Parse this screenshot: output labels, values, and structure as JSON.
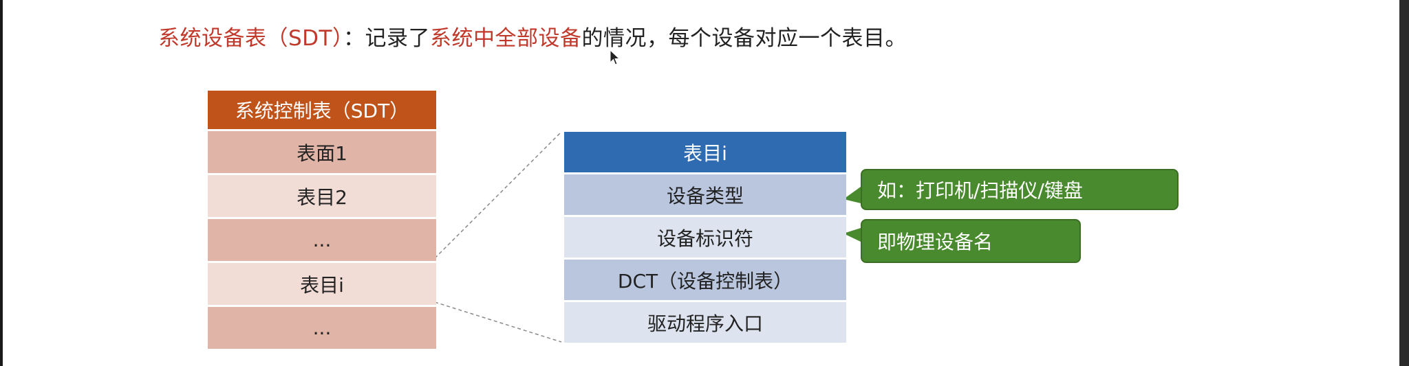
{
  "heading": {
    "term": "系统设备表（SDT）",
    "colon": "：",
    "text_before": "记录了",
    "highlight": "系统中全部设备",
    "text_after": "的情况，每个设备对应一个表目。"
  },
  "sdt_table": {
    "header": "系统控制表（SDT）",
    "rows": [
      "表面1",
      "表目2",
      "...",
      "表目i",
      "..."
    ]
  },
  "entry_table": {
    "header": "表目i",
    "rows": [
      "设备类型",
      "设备标识符",
      "DCT（设备控制表）",
      "驱动程序入口"
    ]
  },
  "callouts": {
    "device_type_note": "如：打印机/扫描仪/键盘",
    "device_id_note": "即物理设备名"
  },
  "colors": {
    "highlight_red": "#c0392b",
    "sdt_header": "#c0531a",
    "sdt_row_dark": "#e0b5a8",
    "sdt_row_light": "#f1dcd6",
    "entry_header": "#2e6bb0",
    "entry_row_dark": "#b9c6dd",
    "entry_row_light": "#dde4ef",
    "callout_green": "#4a8a2e"
  },
  "icons": {
    "cursor": "mouse-pointer-icon"
  }
}
